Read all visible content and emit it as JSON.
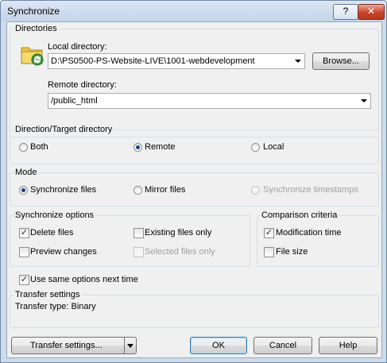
{
  "window": {
    "title": "Synchronize",
    "help_glyph": "?",
    "close_glyph": "✕"
  },
  "directories": {
    "group_label": "Directories",
    "local_label": "Local directory:",
    "local_value": "D:\\PS0500-PS-Website-LIVE\\1001-webdevelopment",
    "browse_label": "Browse...",
    "remote_label": "Remote directory:",
    "remote_value": "/public_html"
  },
  "direction": {
    "group_label": "Direction/Target directory",
    "options": [
      "Both",
      "Remote",
      "Local"
    ],
    "selected": "Remote"
  },
  "mode": {
    "group_label": "Mode",
    "options": [
      "Synchronize files",
      "Mirror files",
      "Synchronize timestamps"
    ],
    "selected": "Synchronize files"
  },
  "sync_options": {
    "group_label": "Synchronize options",
    "delete_files": "Delete files",
    "existing_only": "Existing files only",
    "preview_changes": "Preview changes",
    "selected_only": "Selected files only"
  },
  "comparison": {
    "group_label": "Comparison criteria",
    "modification_time": "Modification time",
    "file_size": "File size"
  },
  "use_same": "Use same options next time",
  "transfer": {
    "group_label": "Transfer settings",
    "type_text": "Transfer type: Binary"
  },
  "buttons": {
    "transfer_settings": "Transfer settings...",
    "ok": "OK",
    "cancel": "Cancel",
    "help": "Help"
  },
  "check_glyph": "✓"
}
